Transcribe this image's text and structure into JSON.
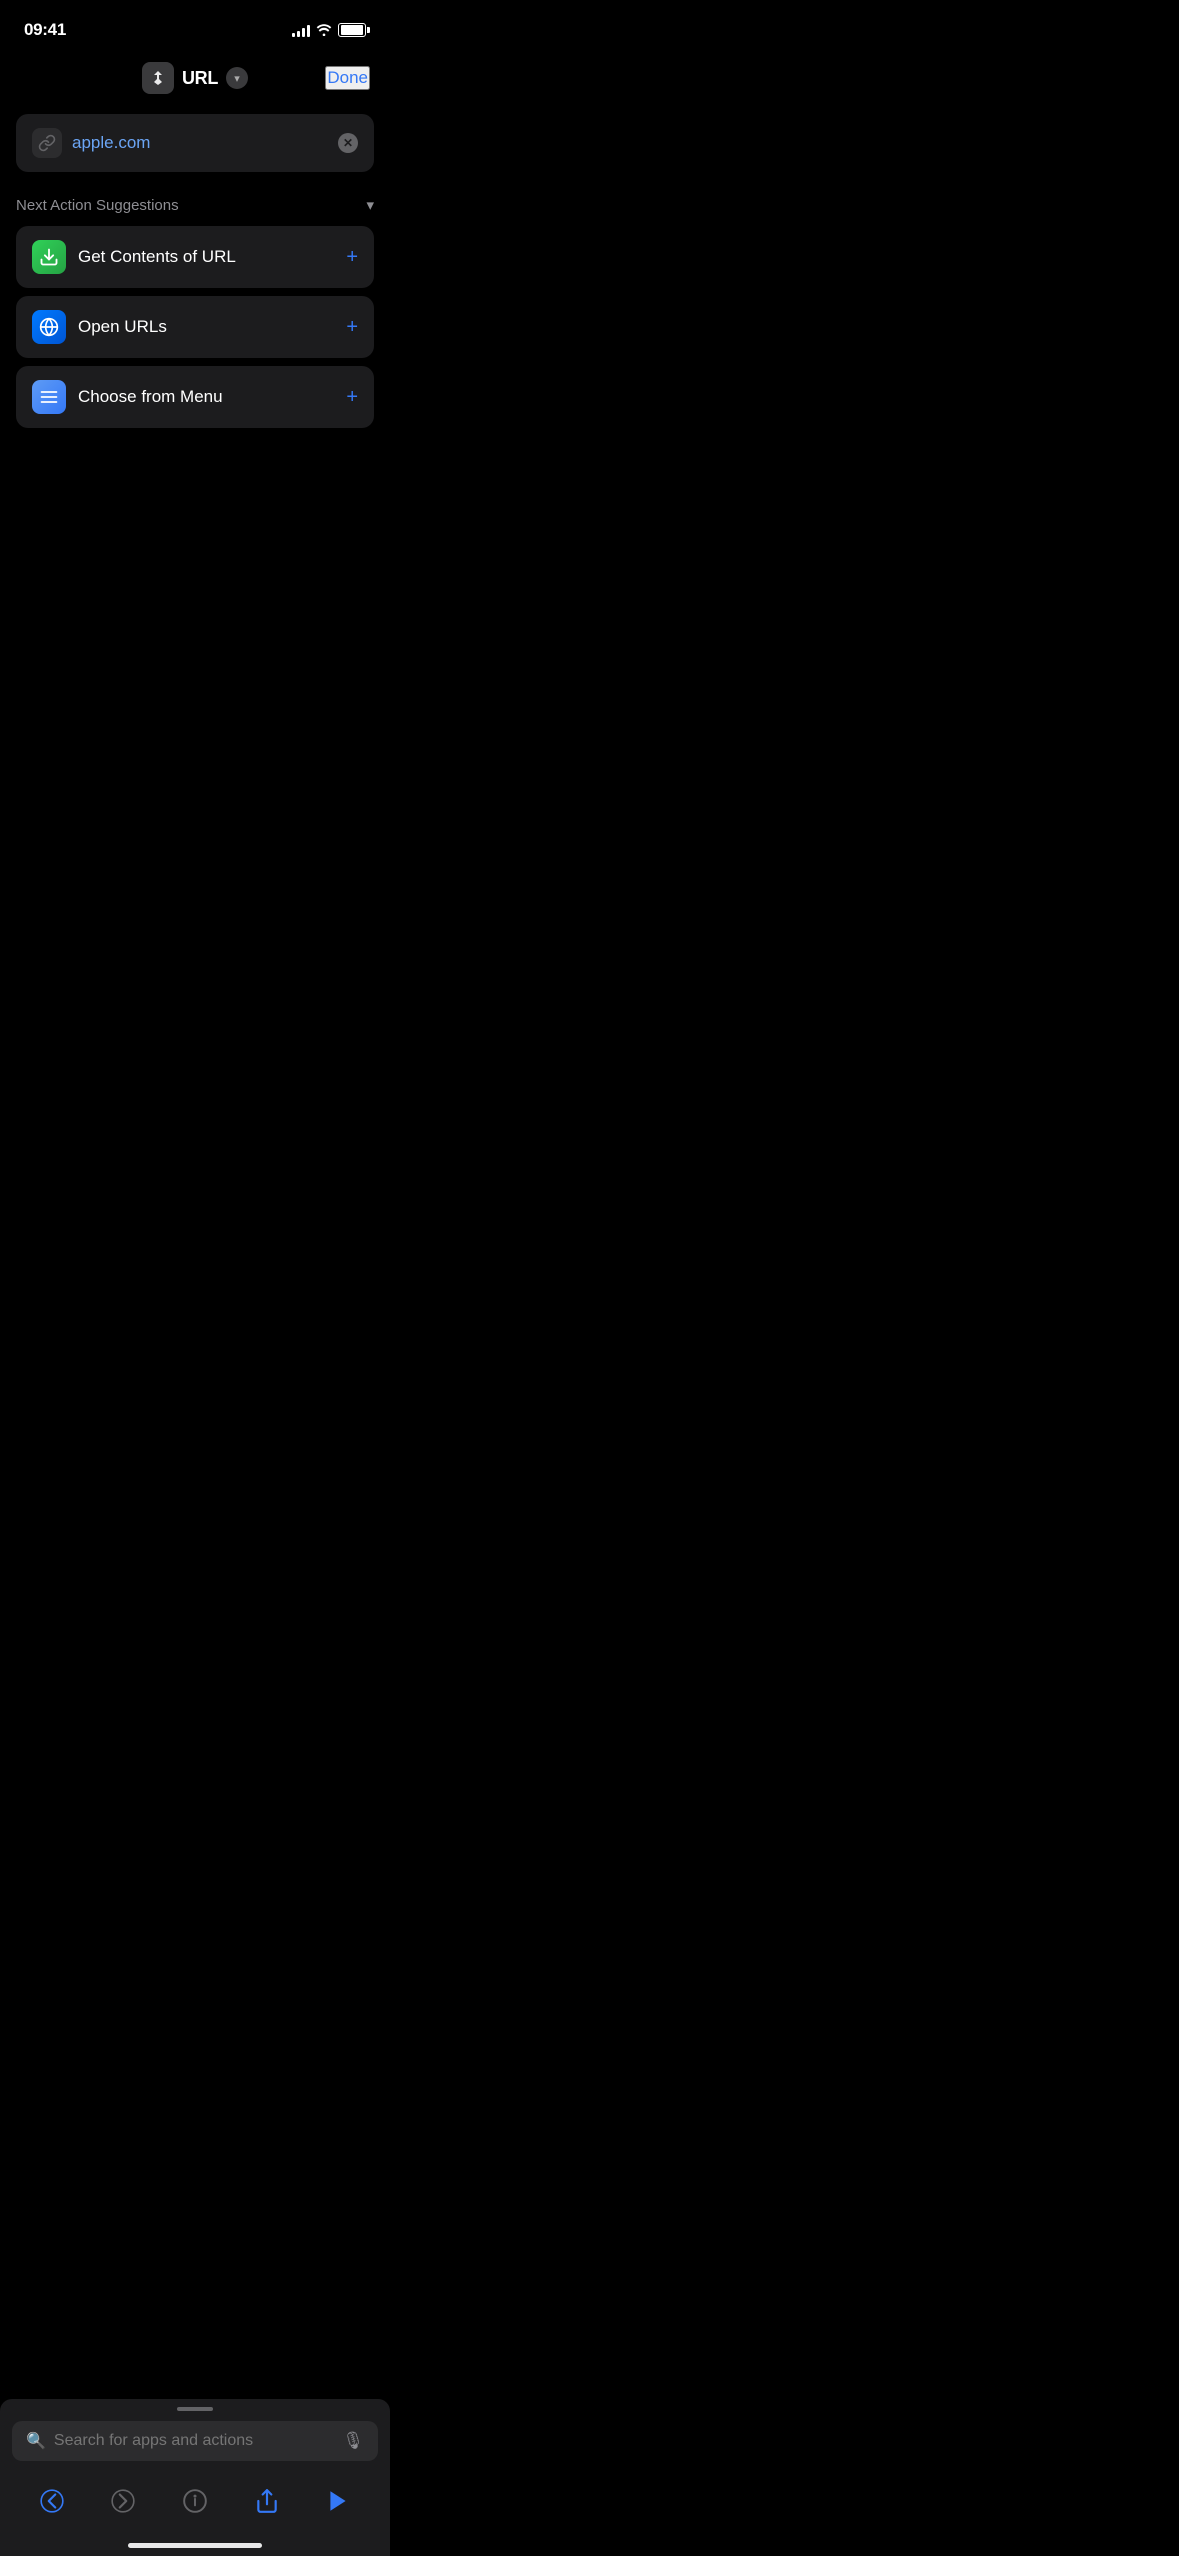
{
  "statusBar": {
    "time": "09:41",
    "battery": "100"
  },
  "navBar": {
    "appIcon": "⬡",
    "title": "URL",
    "doneLabel": "Done"
  },
  "urlInput": {
    "value": "apple.com",
    "placeholder": "apple.com"
  },
  "suggestions": {
    "title": "Next Action Suggestions",
    "chevron": "▾",
    "items": [
      {
        "label": "Get Contents of URL",
        "iconColor": "green",
        "iconSymbol": "↓"
      },
      {
        "label": "Open URLs",
        "iconColor": "safari",
        "iconSymbol": "⊙"
      },
      {
        "label": "Choose from Menu",
        "iconColor": "blue",
        "iconSymbol": "☰"
      }
    ]
  },
  "searchBar": {
    "placeholder": "Search for apps and actions"
  },
  "toolbar": {
    "back": "back",
    "forward": "forward",
    "info": "info",
    "share": "share",
    "play": "play"
  }
}
